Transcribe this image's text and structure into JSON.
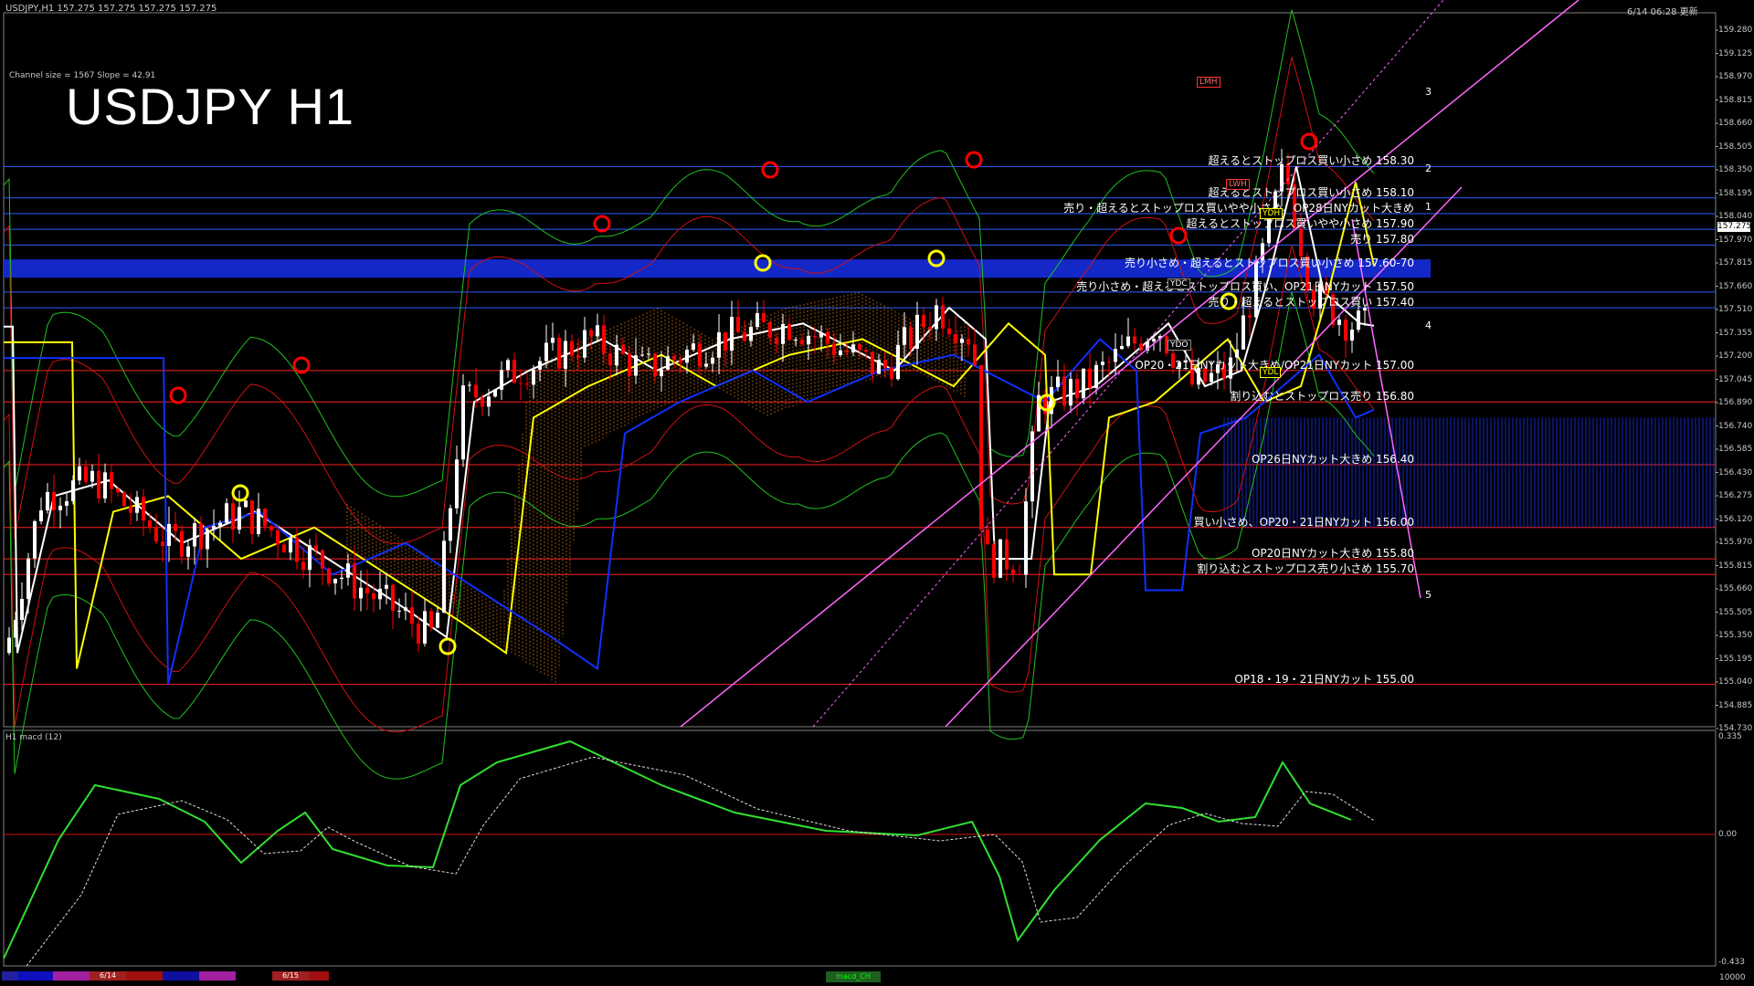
{
  "header": {
    "symbol_info": "USDJPY,H1  157.275 157.275 157.275 157.275",
    "datetime": "6/14 06:28 更新"
  },
  "title": "USDJPY H1",
  "channel_info": "Channel size = 1567 Slope = 42.91",
  "levels": [
    {
      "text": "超えるとストップロス買い小さめ 158.30",
      "price": 158.3,
      "color": "#2b5cff"
    },
    {
      "text": "超えるとストップロス買い小さめ 158.10",
      "price": 158.1,
      "color": "#2b5cff"
    },
    {
      "text": "売り・超えるとストップロス買いやや小さめ、OP28日NYカット大きめ",
      "price": 158.0,
      "color": "#2b5cff"
    },
    {
      "text": "超えるとストップロス買いやや小さめ 157.90",
      "price": 157.9,
      "color": "#2b5cff"
    },
    {
      "text": "売り 157.80",
      "price": 157.8,
      "color": "#2b5cff"
    },
    {
      "text": "売り小さめ・超えるとストップロス買い小さめ 157.60-70",
      "price": 157.65,
      "color": "#1428c8"
    },
    {
      "text": "売り小さめ・超えるとストップロス買い、OP21日NYカット 157.50",
      "price": 157.5,
      "color": "#2b5cff"
    },
    {
      "text": "売り・超えるとストップロス買い 157.40",
      "price": 157.4,
      "color": "#2b5cff"
    },
    {
      "text": "OP20・21日NYカット大きめ/OP21日NYカット 157.00",
      "price": 157.0,
      "color": "#ff2020"
    },
    {
      "text": "割り込むとストップロス売り 156.80",
      "price": 156.8,
      "color": "#ff2020"
    },
    {
      "text": "OP26日NYカット大きめ 156.40",
      "price": 156.4,
      "color": "#ff2020"
    },
    {
      "text": "買い小さめ、OP20・21日NYカット 156.00",
      "price": 156.0,
      "color": "#ff2020"
    },
    {
      "text": "OP20日NYカット大きめ 155.80",
      "price": 155.8,
      "color": "#ff2020"
    },
    {
      "text": "割り込むとストップロス売り小さめ 155.70",
      "price": 155.7,
      "color": "#ff2020"
    },
    {
      "text": "OP18・19・21日NYカット 155.00",
      "price": 155.0,
      "color": "#ff2020"
    }
  ],
  "markers": [
    "1",
    "2",
    "3",
    "4",
    "5"
  ],
  "price_axis": [
    "159.280",
    "159.125",
    "158.970",
    "158.815",
    "158.660",
    "158.505",
    "158.350",
    "158.195",
    "158.040",
    "157.970",
    "157.815",
    "157.660",
    "157.510",
    "157.355",
    "157.200",
    "157.045",
    "156.890",
    "156.740",
    "156.585",
    "156.430",
    "156.275",
    "156.120",
    "155.970",
    "155.815",
    "155.660",
    "155.505",
    "155.350",
    "155.195",
    "155.040",
    "154.885",
    "154.730"
  ],
  "current_price": "157.275",
  "labels": {
    "ydc": "YDC",
    "ydo": "YDO",
    "ydh": "YDH",
    "ydl": "YDL",
    "lwh": "LWH",
    "lmh": "LMH",
    "ydh2": "YDH"
  },
  "macd": {
    "label": "H1  macd (12)",
    "axis": [
      "0.335",
      "0.00",
      "-0.433"
    ],
    "tag": "macd_CH"
  },
  "bottom": {
    "dates": [
      "6/14",
      "6/15"
    ],
    "right_value": "10000"
  },
  "chart_data": {
    "type": "candlestick",
    "title": "USDJPY H1",
    "ylim": [
      154.73,
      159.28
    ],
    "macd_ylim": [
      -0.433,
      0.335
    ]
  },
  "colors": {
    "bg": "#000000",
    "grid_blue": "#2b5cff",
    "grid_red": "#ff2020",
    "white_ma": "#ffffff",
    "yellow_ma": "#ffff00",
    "blue_ma": "#1030ff",
    "band_green": "#20c020",
    "band_red": "#d01010",
    "channel": "#ff66ff",
    "bull": "#ffffff",
    "bear": "#ff0000"
  }
}
